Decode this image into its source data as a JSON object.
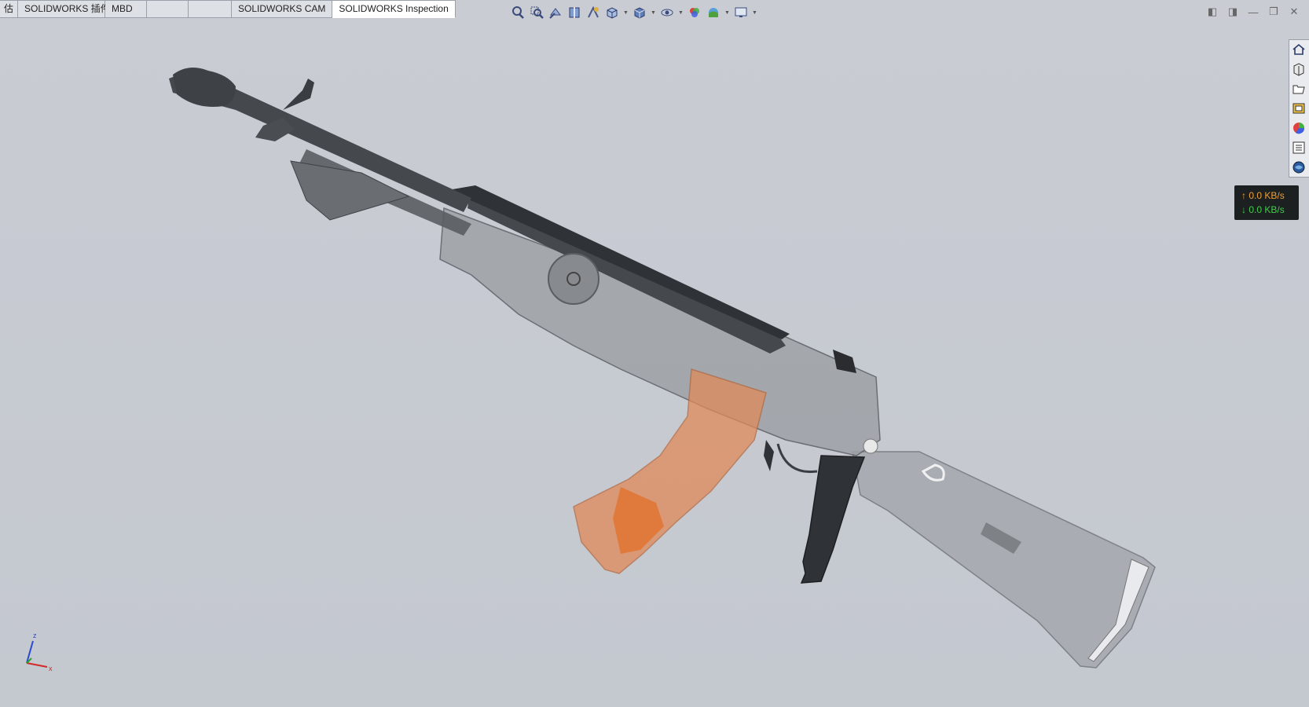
{
  "tabs": [
    {
      "label": "估"
    },
    {
      "label": "SOLIDWORKS 插件"
    },
    {
      "label": "MBD"
    },
    {
      "label": ""
    },
    {
      "label": ""
    },
    {
      "label": "SOLIDWORKS CAM"
    },
    {
      "label": "SOLIDWORKS Inspection",
      "active": true
    }
  ],
  "view_toolbar": [
    "zoom-to-fit-icon",
    "zoom-to-area-icon",
    "previous-view-icon",
    "section-view-icon",
    "dynamic-annotation-icon",
    "view-orientation-icon",
    "display-style-icon",
    "hide-show-items-icon",
    "edit-appearance-icon",
    "apply-scene-icon",
    "view-settings-icon"
  ],
  "task_pane": [
    "home-icon",
    "design-library-icon",
    "file-explorer-icon",
    "view-palette-icon",
    "appearances-icon",
    "custom-properties-icon",
    "forum-icon"
  ],
  "net_monitor": {
    "upload": "↑ 0.0 KB/s",
    "download": "↓ 0.0 KB/s"
  },
  "triad": {
    "x": "x",
    "z": "z"
  },
  "colors": {
    "background": "#c6c9d0",
    "metal": "#4a4d52",
    "magazine": "#e07a3c",
    "transparent": "#9ea1a6"
  }
}
